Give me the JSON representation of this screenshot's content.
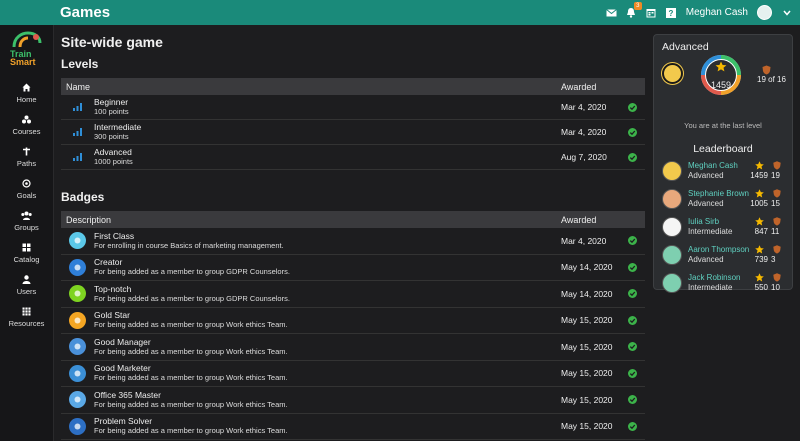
{
  "header": {
    "title": "Games",
    "user_name": "Meghan Cash",
    "notification_count": "3"
  },
  "sidebar": {
    "logo_line1": "Train",
    "logo_line2": "Smart",
    "items": [
      {
        "label": "Home",
        "icon": "home-icon"
      },
      {
        "label": "Courses",
        "icon": "courses-icon"
      },
      {
        "label": "Paths",
        "icon": "paths-icon"
      },
      {
        "label": "Goals",
        "icon": "goals-icon"
      },
      {
        "label": "Groups",
        "icon": "groups-icon"
      },
      {
        "label": "Catalog",
        "icon": "catalog-icon"
      },
      {
        "label": "Users",
        "icon": "users-icon"
      },
      {
        "label": "Resources",
        "icon": "resources-icon"
      }
    ]
  },
  "page": {
    "title": "Site-wide game",
    "levels_heading": "Levels",
    "levels_columns": [
      "Name",
      "Awarded"
    ],
    "levels": [
      {
        "name": "Beginner",
        "points": "100 points",
        "awarded": "Mar 4, 2020"
      },
      {
        "name": "Intermediate",
        "points": "300 points",
        "awarded": "Mar 4, 2020"
      },
      {
        "name": "Advanced",
        "points": "1000 points",
        "awarded": "Aug 7, 2020"
      }
    ],
    "badges_heading": "Badges",
    "badges_columns": [
      "Description",
      "Awarded"
    ],
    "badges": [
      {
        "name": "First Class",
        "desc": "For enrolling in course Basics of marketing management.",
        "awarded": "Mar 4, 2020",
        "color": "#5bc8e8"
      },
      {
        "name": "Creator",
        "desc": "For being added as a member to group GDPR Counselors.",
        "awarded": "May 14, 2020",
        "color": "#2f7fd8"
      },
      {
        "name": "Top-notch",
        "desc": "For being added as a member to group GDPR Counselors.",
        "awarded": "May 14, 2020",
        "color": "#7ed321"
      },
      {
        "name": "Gold Star",
        "desc": "For being added as a member to group Work ethics Team.",
        "awarded": "May 15, 2020",
        "color": "#f5a623"
      },
      {
        "name": "Good Manager",
        "desc": "For being added as a member to group Work ethics Team.",
        "awarded": "May 15, 2020",
        "color": "#4a90d9"
      },
      {
        "name": "Good Marketer",
        "desc": "For being added as a member to group Work ethics Team.",
        "awarded": "May 15, 2020",
        "color": "#3b8fd6"
      },
      {
        "name": "Office 365 Master",
        "desc": "For being added as a member to group Work ethics Team.",
        "awarded": "May 15, 2020",
        "color": "#5aa8e6"
      },
      {
        "name": "Problem Solver",
        "desc": "For being added as a member to group Work ethics Team.",
        "awarded": "May 15, 2020",
        "color": "#2d6fc4"
      }
    ]
  },
  "panel": {
    "title": "Advanced",
    "points": "1459",
    "level_position": "19 of 16",
    "last_level_text": "You are at the last level",
    "leaderboard_title": "Leaderboard",
    "leaders": [
      {
        "name": "Meghan Cash",
        "level": "Advanced",
        "points": "1459",
        "badges": "19",
        "avatar_color": "#f2c94c"
      },
      {
        "name": "Stephanie Brown",
        "level": "Advanced",
        "points": "1005",
        "badges": "15",
        "avatar_color": "#e8a87c"
      },
      {
        "name": "Iulia Sirb",
        "level": "Intermediate",
        "points": "847",
        "badges": "11",
        "avatar_color": "#f5f5f5"
      },
      {
        "name": "Aaron Thompson",
        "level": "Advanced",
        "points": "739",
        "badges": "3",
        "avatar_color": "#7ecfb0"
      },
      {
        "name": "Jack Robinson",
        "level": "Intermediate",
        "points": "550",
        "badges": "10",
        "avatar_color": "#7ecfb0"
      }
    ]
  },
  "colors": {
    "brand": "#1a8a7a",
    "check": "#3cb34a",
    "star": "#f5b800",
    "shield": "#c0642a"
  }
}
